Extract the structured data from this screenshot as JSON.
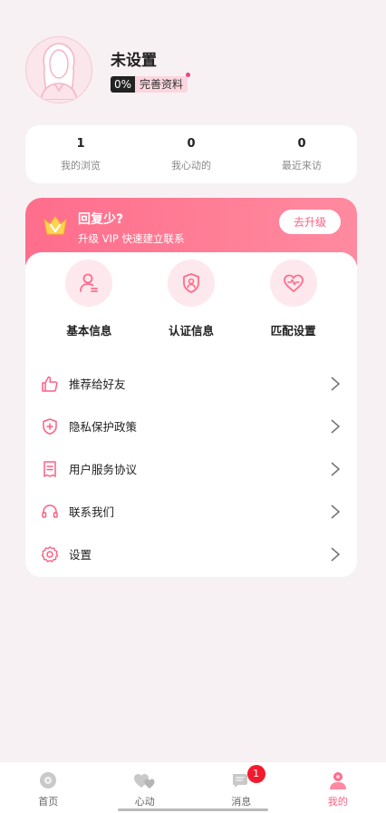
{
  "profile": {
    "nickname": "未设置",
    "completion_percent": "0%",
    "complete_label": "完善资料"
  },
  "stats": [
    {
      "value": "1",
      "label": "我的浏览"
    },
    {
      "value": "0",
      "label": "我心动的"
    },
    {
      "value": "0",
      "label": "最近来访"
    }
  ],
  "vip": {
    "title": "回复少?",
    "subtitle": "升级 VIP 快速建立联系",
    "upgrade_label": "去升级"
  },
  "quick_actions": [
    {
      "label": "基本信息",
      "icon": "person-edit-icon"
    },
    {
      "label": "认证信息",
      "icon": "shield-verify-icon"
    },
    {
      "label": "匹配设置",
      "icon": "heart-match-icon"
    }
  ],
  "menu": [
    {
      "label": "推荐给好友",
      "icon": "thumbs-up-icon"
    },
    {
      "label": "隐私保护政策",
      "icon": "shield-plus-icon"
    },
    {
      "label": "用户服务协议",
      "icon": "document-icon"
    },
    {
      "label": "联系我们",
      "icon": "headset-icon"
    },
    {
      "label": "设置",
      "icon": "gear-icon"
    }
  ],
  "bottom_nav": [
    {
      "label": "首页",
      "icon": "home-icon"
    },
    {
      "label": "心动",
      "icon": "hearts-icon"
    },
    {
      "label": "消息",
      "icon": "message-icon",
      "badge": "1"
    },
    {
      "label": "我的",
      "icon": "profile-icon",
      "active": true
    }
  ],
  "colors": {
    "accent": "#ff5f83",
    "vip_gradient_start": "#ff6d8c",
    "badge_red": "#f21b2d",
    "background": "#f8f1f4"
  }
}
